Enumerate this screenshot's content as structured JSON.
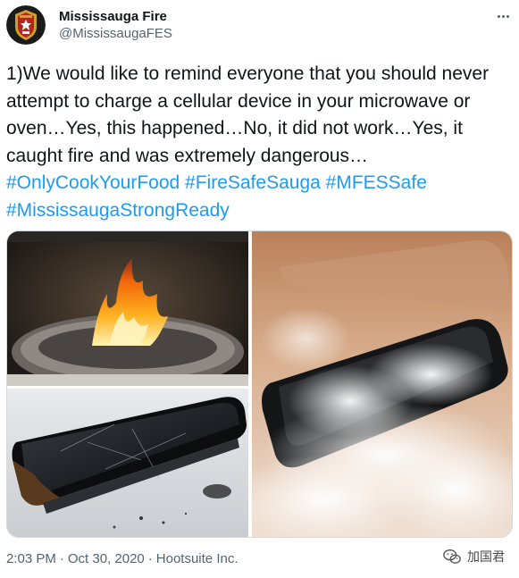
{
  "author": {
    "display_name": "Mississauga Fire",
    "handle": "@MississaugaFES",
    "avatar_icon": "fire-department-crest"
  },
  "tweet": {
    "text": "1)We would like to remind everyone that you should never attempt to charge a cellular device in your microwave or oven…Yes, this happened…No, it did not work…Yes, it caught fire and was extremely dangerous…",
    "hashtags": [
      "#OnlyCookYourFood",
      "#FireSafeSauga",
      "#MFESSafe",
      "#MississaugaStrongReady"
    ]
  },
  "footer": {
    "time": "2:03 PM",
    "separator": "·",
    "date": "Oct 30, 2020",
    "source": "Hootsuite Inc."
  },
  "watermark": {
    "text": "加国君",
    "icon": "wechat-icon"
  },
  "colors": {
    "hashtag": "#1d9bf0",
    "secondary_text": "#536471",
    "primary_text": "#0f1419"
  }
}
